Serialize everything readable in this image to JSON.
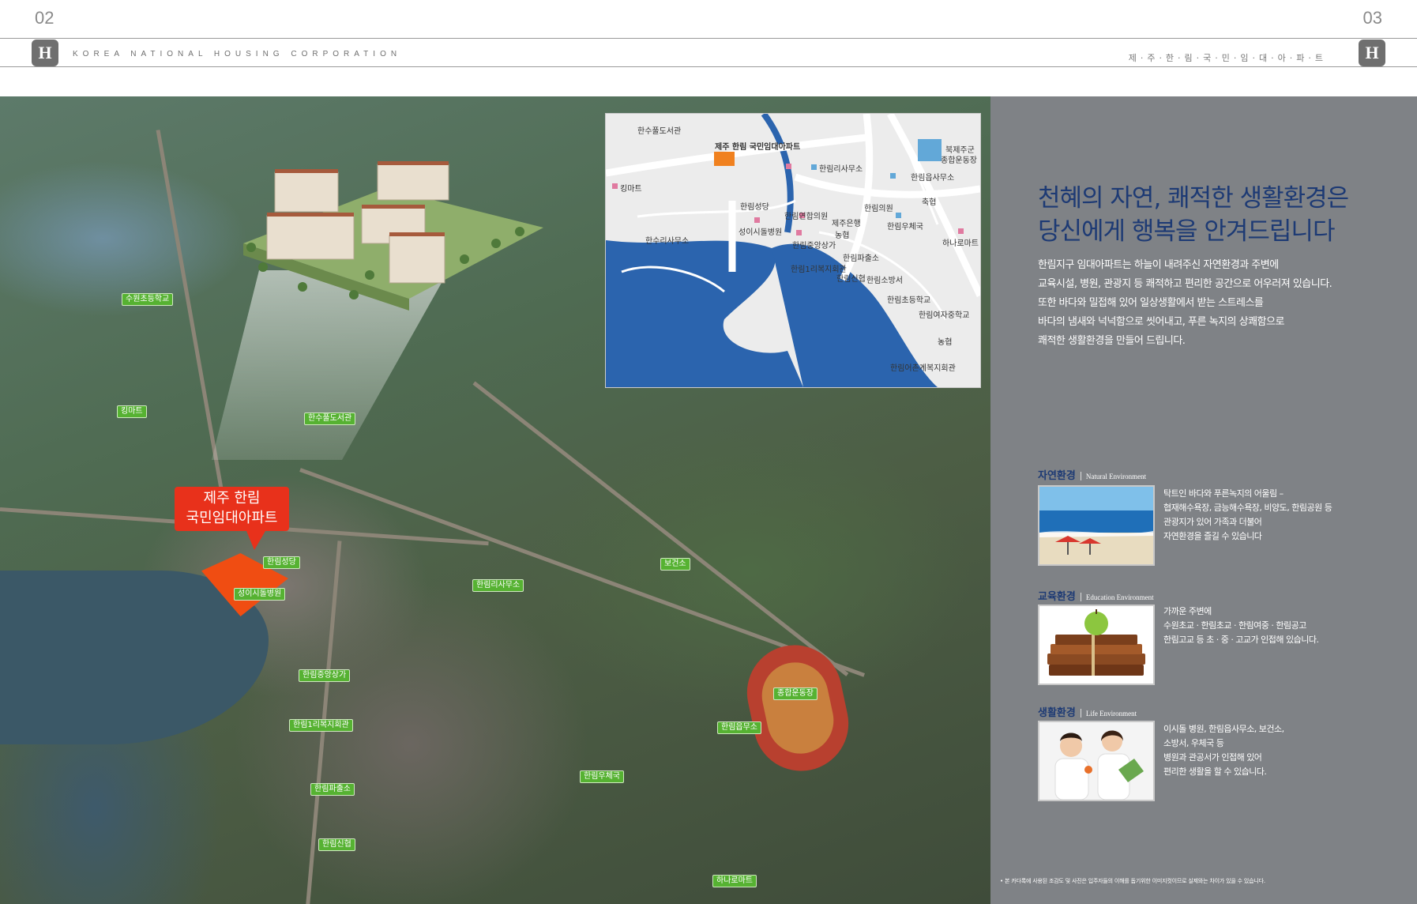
{
  "header": {
    "page_left": "02",
    "page_right": "03",
    "corporation": "KOREA NATIONAL HOUSING CORPORATION",
    "brand": "제·주·한·림·국·민·임·대·아·파·트",
    "logo_glyph": "H"
  },
  "aerial": {
    "callout": {
      "line1": "제주 한림",
      "line2": "국민임대아파트"
    },
    "labels": [
      {
        "name": "label-suwon-school",
        "text": "수원초등학교"
      },
      {
        "name": "label-king-mart",
        "text": "킹마트"
      },
      {
        "name": "label-hansu-library",
        "text": "한수풀도서관"
      },
      {
        "name": "label-hallim-church",
        "text": "한림성당"
      },
      {
        "name": "label-isidore-hospital",
        "text": "성이시돌병원"
      },
      {
        "name": "label-hallim-office",
        "text": "한림리사무소"
      },
      {
        "name": "label-health-center",
        "text": "보건소"
      },
      {
        "name": "label-hallim-arcade",
        "text": "한림중앙상가"
      },
      {
        "name": "label-stadium",
        "text": "종합운동장"
      },
      {
        "name": "label-welfare-hall",
        "text": "한림1리복지회관"
      },
      {
        "name": "label-town-office",
        "text": "한림읍무소"
      },
      {
        "name": "label-police-box",
        "text": "한림파출소"
      },
      {
        "name": "label-post-office",
        "text": "한림우체국"
      },
      {
        "name": "label-hallim-credit",
        "text": "한림신협"
      },
      {
        "name": "label-hanaro-mart",
        "text": "하나로마트"
      }
    ]
  },
  "map": {
    "labels": [
      {
        "name": "map-label-hansu-library",
        "text": "한수풀도서관"
      },
      {
        "name": "map-label-site",
        "text": "제주 한림 국민임대아파트"
      },
      {
        "name": "map-label-north-jeju-stadium",
        "text": "북제주군"
      },
      {
        "name": "map-label-north-jeju-stadium-2",
        "text": "종합운동장"
      },
      {
        "name": "map-label-king-mart",
        "text": "킹마트"
      },
      {
        "name": "map-label-hallim-ri-office",
        "text": "한림리사무소"
      },
      {
        "name": "map-label-hallim-eup-office",
        "text": "한림읍사무소"
      },
      {
        "name": "map-label-nonghyup-1",
        "text": "축협"
      },
      {
        "name": "map-label-hallim-church",
        "text": "한림성당"
      },
      {
        "name": "map-label-hallim-union",
        "text": "한림연합의원"
      },
      {
        "name": "map-label-hallim-clinic",
        "text": "한림의원"
      },
      {
        "name": "map-label-jeju-bank",
        "text": "제주은행"
      },
      {
        "name": "map-label-post",
        "text": "한림우체국"
      },
      {
        "name": "map-label-hansu-ri",
        "text": "한수리사무소"
      },
      {
        "name": "map-label-isidore",
        "text": "성이시돌병원"
      },
      {
        "name": "map-label-nonghyup-2",
        "text": "농협"
      },
      {
        "name": "map-label-hanaro",
        "text": "하나로마트"
      },
      {
        "name": "map-label-arcade",
        "text": "한림중앙상가"
      },
      {
        "name": "map-label-police",
        "text": "한림파출소"
      },
      {
        "name": "map-label-welfare",
        "text": "한림1리복지회관"
      },
      {
        "name": "map-label-credit",
        "text": "한림신협"
      },
      {
        "name": "map-label-fire",
        "text": "한림소방서"
      },
      {
        "name": "map-label-elementary",
        "text": "한림초등학교"
      },
      {
        "name": "map-label-girls-middle",
        "text": "한림여자중학교"
      },
      {
        "name": "map-label-nonghyup-3",
        "text": "농협"
      },
      {
        "name": "map-label-fishing-village",
        "text": "한림어촌계복지회관"
      }
    ]
  },
  "side": {
    "headline_line1": "천혜의 자연, 쾌적한 생활환경은",
    "headline_line2": "당신에게 행복을 안겨드립니다",
    "intro": [
      "한림지구 임대아파트는 하늘이 내려주신 자연환경과 주변에",
      "교육시설, 병원, 관광지 등 쾌적하고 편리한 공간으로 어우러져 있습니다.",
      "또한 바다와 밀접해 있어 일상생활에서 받는 스트레스를",
      "바다의 냄새와 넉넉함으로 씻어내고, 푸른 녹지의 상쾌함으로",
      "쾌적한 생활환경을 만들어 드립니다."
    ],
    "sections": [
      {
        "title": "자연환경",
        "subtitle": "Natural Environment",
        "lines": [
          "탁트인 바다와 푸른녹지의 어울림 –",
          "협재해수욕장, 금능해수욕장, 비양도, 한림공원 등",
          "관광지가 있어 가족과 더불어",
          "자연환경을 즐길 수 있습니다"
        ]
      },
      {
        "title": "교육환경",
        "subtitle": "Education Environment",
        "lines": [
          "가까운 주변에",
          "수원초교 · 한림초교 · 한림여중 · 한림공고",
          "한림고교 등 초 · 중 · 고교가 인접해 있습니다."
        ]
      },
      {
        "title": "생활환경",
        "subtitle": "Life Environment",
        "lines": [
          "이시돌 병원, 한림읍사무소, 보건소,",
          "소방서, 우체국 등",
          "병원과 관공서가 인접해 있어",
          "편리한 생활을 할 수 있습니다."
        ]
      }
    ],
    "note": "• 본 카다록에 사용된 조감도 및 사진은 입주자들의 이해를 돕기위한 이미지컷이므로 실제와는 차이가 있을 수 있습니다."
  }
}
